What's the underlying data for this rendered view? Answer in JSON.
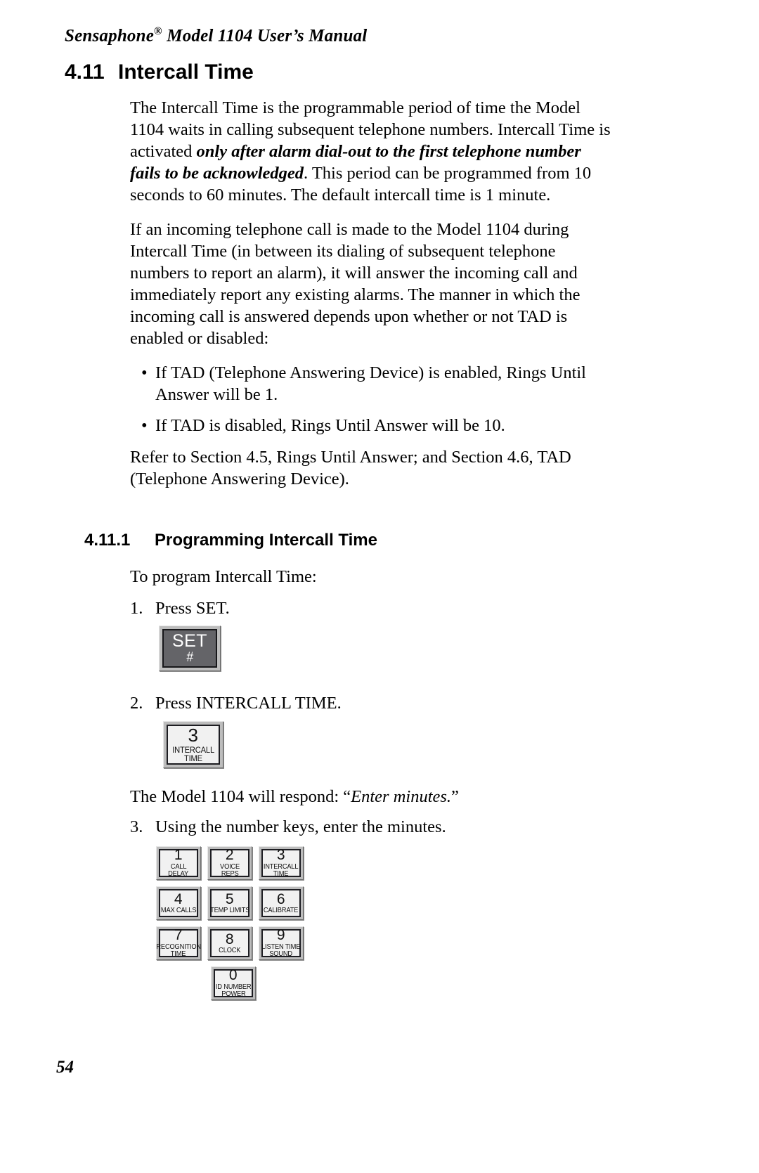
{
  "header": {
    "running_head_pre": "Sensaphone",
    "running_head_sup": "®",
    "running_head_post": " Model 1104 User’s Manual"
  },
  "section": {
    "number": "4.11",
    "title": "Intercall Time"
  },
  "paragraphs": {
    "p1_a": "The Intercall Time is the programmable period of time the Model 1104 waits in calling subsequent telephone numbers.  Intercall Time is activated ",
    "p1_emph": "only after alarm dial-out to the first telephone number fails to be acknowledged",
    "p1_b": ". This period can be programmed from 10 seconds to 60 minutes. The default intercall time is 1 minute.",
    "p2": "If an incoming telephone call is made to the Model 1104 during Intercall Time (in between its dialing of subsequent telephone numbers to report an alarm), it will answer the incoming call and immediately report any existing alarms. The manner in which the incoming call is answered depends upon whether or not TAD is enabled or disabled:",
    "p3": "Refer to Section 4.5, Rings Until Answer; and Section 4.6, TAD (Telephone Answering Device)."
  },
  "bullets": [
    "If  TAD (Telephone Answering Device) is enabled, Rings Until Answer will be 1.",
    "If  TAD is disabled, Rings Until Answer will be 10."
  ],
  "bullet_marker": "•",
  "subsection": {
    "number": "4.11.1",
    "title": "Programming Intercall Time",
    "intro": "To program Intercall Time:"
  },
  "steps": [
    {
      "num": "1.",
      "text": "Press SET."
    },
    {
      "num": "2.",
      "text": "Press INTERCALL TIME."
    },
    {
      "num": "3.",
      "text": "Using the number keys, enter the minutes."
    }
  ],
  "respond": {
    "prefix": "The  Model 1104 will respond: “",
    "message": "Enter minutes.",
    "suffix": "”"
  },
  "keys": {
    "set": {
      "big": "SET",
      "small": "#",
      "face_color": "#646468",
      "text_color": "#ffffff"
    },
    "intercall": {
      "big": "3",
      "line1": "INTERCALL",
      "line2": "TIME"
    }
  },
  "keypad": {
    "rows": [
      [
        {
          "big": "1",
          "line1": "CALL",
          "line2": "DELAY"
        },
        {
          "big": "2",
          "line1": "VOICE",
          "line2": "REPS"
        },
        {
          "big": "3",
          "line1": "INTERCALL",
          "line2": "TIME"
        }
      ],
      [
        {
          "big": "4",
          "line1": "MAX CALLS",
          "line2": ""
        },
        {
          "big": "5",
          "line1": "TEMP LIMITS",
          "line2": ""
        },
        {
          "big": "6",
          "line1": "CALIBRATE",
          "line2": ""
        }
      ],
      [
        {
          "big": "7",
          "line1": "RECOGNITION",
          "line2": "TIME"
        },
        {
          "big": "8",
          "line1": "CLOCK",
          "line2": ""
        },
        {
          "big": "9",
          "line1": "LISTEN TIME",
          "line2": "SOUND"
        }
      ],
      [
        {
          "big": "0",
          "line1": "ID NUMBER",
          "line2": "POWER"
        }
      ]
    ]
  },
  "footer": {
    "page_number": "54"
  },
  "colors": {
    "key_bezel": "#bdbdbd",
    "key_face_light": "#f1f1f1",
    "key_face_dark": "#646468",
    "text": "#000000"
  }
}
